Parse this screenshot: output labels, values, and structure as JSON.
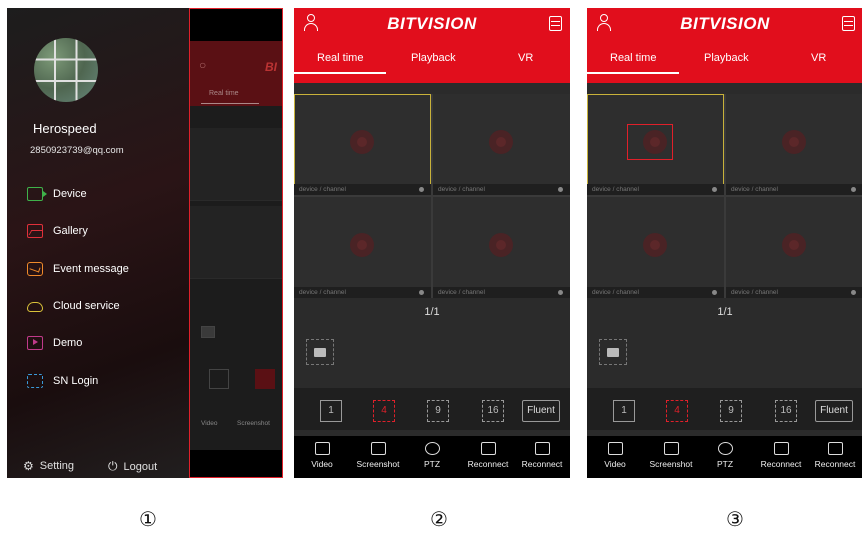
{
  "screen1": {
    "profile": {
      "name": "Herospeed",
      "email": "2850923739@qq.com"
    },
    "menu": [
      {
        "label": "Device",
        "icon": "device-icon",
        "color": "#3fb24a"
      },
      {
        "label": "Gallery",
        "icon": "gallery-icon",
        "color": "#e0303a"
      },
      {
        "label": "Event message",
        "icon": "event-message-icon",
        "color": "#f08a2a"
      },
      {
        "label": "Cloud service",
        "icon": "cloud-icon",
        "color": "#d9c23a"
      },
      {
        "label": "Demo",
        "icon": "demo-icon",
        "color": "#c03a8a"
      },
      {
        "label": "SN Login",
        "icon": "sn-login-icon",
        "color": "#3a9ad9"
      }
    ],
    "setting_label": "Setting",
    "logout_label": "Logout",
    "behind": {
      "brand": "BI",
      "tab": "Real time",
      "bottom_labels": [
        "Video",
        "Screenshot"
      ]
    }
  },
  "live": {
    "brand": "BITVISION",
    "tabs": [
      "Real time",
      "Playback",
      "VR"
    ],
    "active_tab": "Real time",
    "cell_label": "device / channel",
    "page_indicator": "1/1",
    "splits": [
      "1",
      "4",
      "9",
      "16"
    ],
    "active_split": "4",
    "quality_label": "Fluent",
    "actions": [
      "Video",
      "Screenshot",
      "PTZ",
      "Reconnect",
      "Reconnect"
    ]
  },
  "captions": [
    "①",
    "②",
    "③"
  ],
  "colors": {
    "brand_red": "#e10e1c",
    "highlight": "#e0202a",
    "selected_cell": "#c8b23a"
  }
}
